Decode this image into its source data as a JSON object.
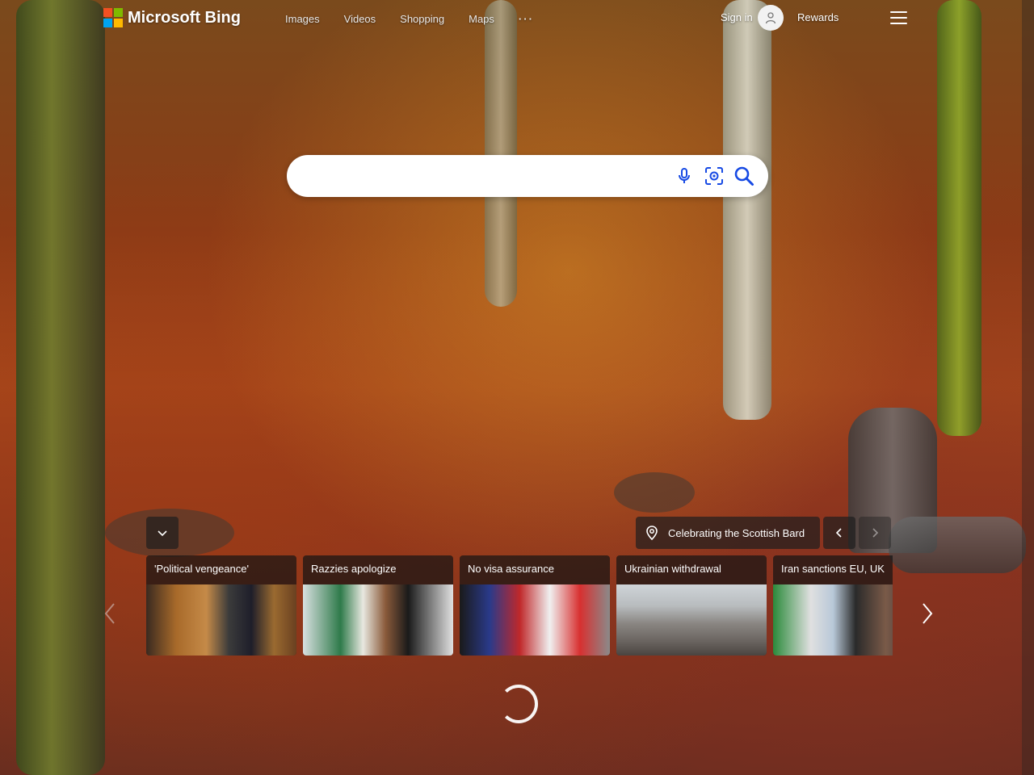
{
  "header": {
    "logo_text": "Microsoft Bing",
    "nav": [
      {
        "label": "Images"
      },
      {
        "label": "Videos"
      },
      {
        "label": "Shopping"
      },
      {
        "label": "Maps"
      },
      {
        "label": "···"
      }
    ],
    "signin_label": "Sign in",
    "rewards_label": "Rewards",
    "menu_icon": "hamburger-icon"
  },
  "search": {
    "value": "",
    "placeholder": "",
    "icons": [
      "microphone-icon",
      "visual-search-icon",
      "search-icon"
    ]
  },
  "image_info": {
    "location_label": "Celebrating the Scottish Bard",
    "collapse_icon": "chevron-down-icon",
    "prev_icon": "chevron-left-icon",
    "next_icon": "chevron-right-icon"
  },
  "news": [
    {
      "title": "'Political vengeance'"
    },
    {
      "title": "Razzies apologize"
    },
    {
      "title": "No visa assurance"
    },
    {
      "title": "Ukrainian withdrawal"
    },
    {
      "title": "Iran sanctions EU, UK"
    }
  ],
  "colors": {
    "ms_red": "#f25022",
    "ms_green": "#7fba00",
    "ms_blue": "#00a4ef",
    "ms_yellow": "#ffb900",
    "search_icon_blue": "#174ae4"
  }
}
